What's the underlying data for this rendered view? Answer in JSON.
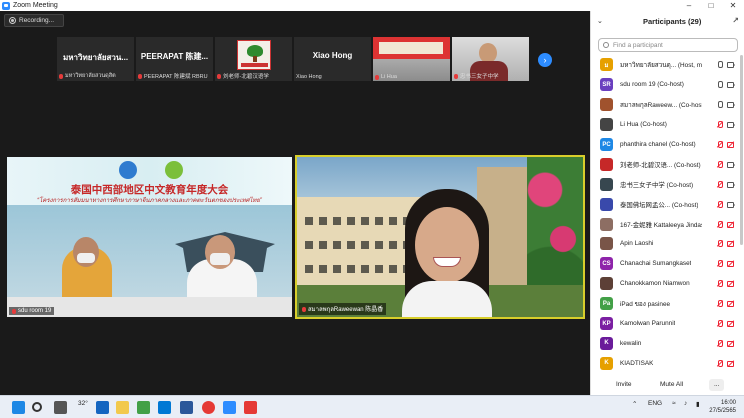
{
  "window": {
    "title": "Zoom Meeting"
  },
  "recording": {
    "label": "Recording..."
  },
  "strip": [
    {
      "big": "มหาวิทยาลัยสวน...",
      "caption": "มหาวิทยาลัยสวนดุสิต"
    },
    {
      "big": "PEERAPAT 陈建...",
      "caption": "PEERAPAT 陈建斌 RBRU"
    },
    {
      "big": "",
      "caption": "刘老师-北碧汉语学"
    },
    {
      "big": "Xiao Hong",
      "caption": "Xiao Hong"
    },
    {
      "big": "",
      "caption": "Li Hua"
    },
    {
      "big": "",
      "caption": "忠书三女子中学"
    }
  ],
  "video1": {
    "title": "泰国中西部地区中文教育年度大会",
    "subtitle": "“โครงการการสัมมนาทางการศึกษาภาษาจีนภาคกลางและภาคตะวันตกของประเทศไทย”",
    "label": "sdu room 19"
  },
  "video2": {
    "label": "สมาลพกุลRaweewan 陈晶香"
  },
  "panel": {
    "title": "Participants (29)",
    "search_placeholder": "Find a participant",
    "participants": [
      {
        "initials": "ม",
        "color": "#e6a000",
        "name": "มหาวิทยาลัยสวนดุ... (Host, me)",
        "mic": "on",
        "cam": "on"
      },
      {
        "initials": "SR",
        "color": "#6a3fbf",
        "name": "sdu room 19 (Co-host)",
        "mic": "on",
        "cam": "on"
      },
      {
        "initials": "",
        "color": "#a0522d",
        "name": "สมาลพกุลRaweew... (Co-host)",
        "mic": "on",
        "cam": "on"
      },
      {
        "initials": "",
        "color": "#444",
        "name": "Li Hua (Co-host)",
        "mic": "off",
        "cam": "on"
      },
      {
        "initials": "PC",
        "color": "#1e88e5",
        "name": "phanthira chanel (Co-host)",
        "mic": "off",
        "cam": "off"
      },
      {
        "initials": "",
        "color": "#c62828",
        "name": "刘老师-北碧汉语... (Co-host)",
        "mic": "off",
        "cam": "on"
      },
      {
        "initials": "",
        "color": "#37474f",
        "name": "忠书三女子中学 (Co-host)",
        "mic": "off",
        "cam": "on"
      },
      {
        "initials": "",
        "color": "#3949ab",
        "name": "泰国佛坛网孟公... (Co-host)",
        "mic": "off",
        "cam": "on"
      },
      {
        "initials": "",
        "color": "#8d6e63",
        "name": "167-金妮雅 Kattaleeya Jindasat...",
        "mic": "off",
        "cam": "off"
      },
      {
        "initials": "",
        "color": "#795548",
        "name": "Apin Laoshi",
        "mic": "off",
        "cam": "off"
      },
      {
        "initials": "CS",
        "color": "#8e24aa",
        "name": "Chanachai Sumangkaset",
        "mic": "off",
        "cam": "off"
      },
      {
        "initials": "",
        "color": "#5d4037",
        "name": "Chanokkamon Niamwon",
        "mic": "off",
        "cam": "off"
      },
      {
        "initials": "Pa",
        "color": "#43a047",
        "name": "iPad ของ pasinee",
        "mic": "off",
        "cam": "off"
      },
      {
        "initials": "KP",
        "color": "#7b1fa2",
        "name": "Kamolwan Parunnit",
        "mic": "off",
        "cam": "off"
      },
      {
        "initials": "K",
        "color": "#6a1b9a",
        "name": "kewalin",
        "mic": "off",
        "cam": "off"
      },
      {
        "initials": "K",
        "color": "#e6a000",
        "name": "KIADTISAK",
        "mic": "off",
        "cam": "off"
      }
    ],
    "invite": "Invite",
    "mute_all": "Mute All",
    "more": "..."
  },
  "taskbar": {
    "weather": "32°",
    "lang": "ENG",
    "time": "16:00",
    "date": "27/5/2565"
  }
}
